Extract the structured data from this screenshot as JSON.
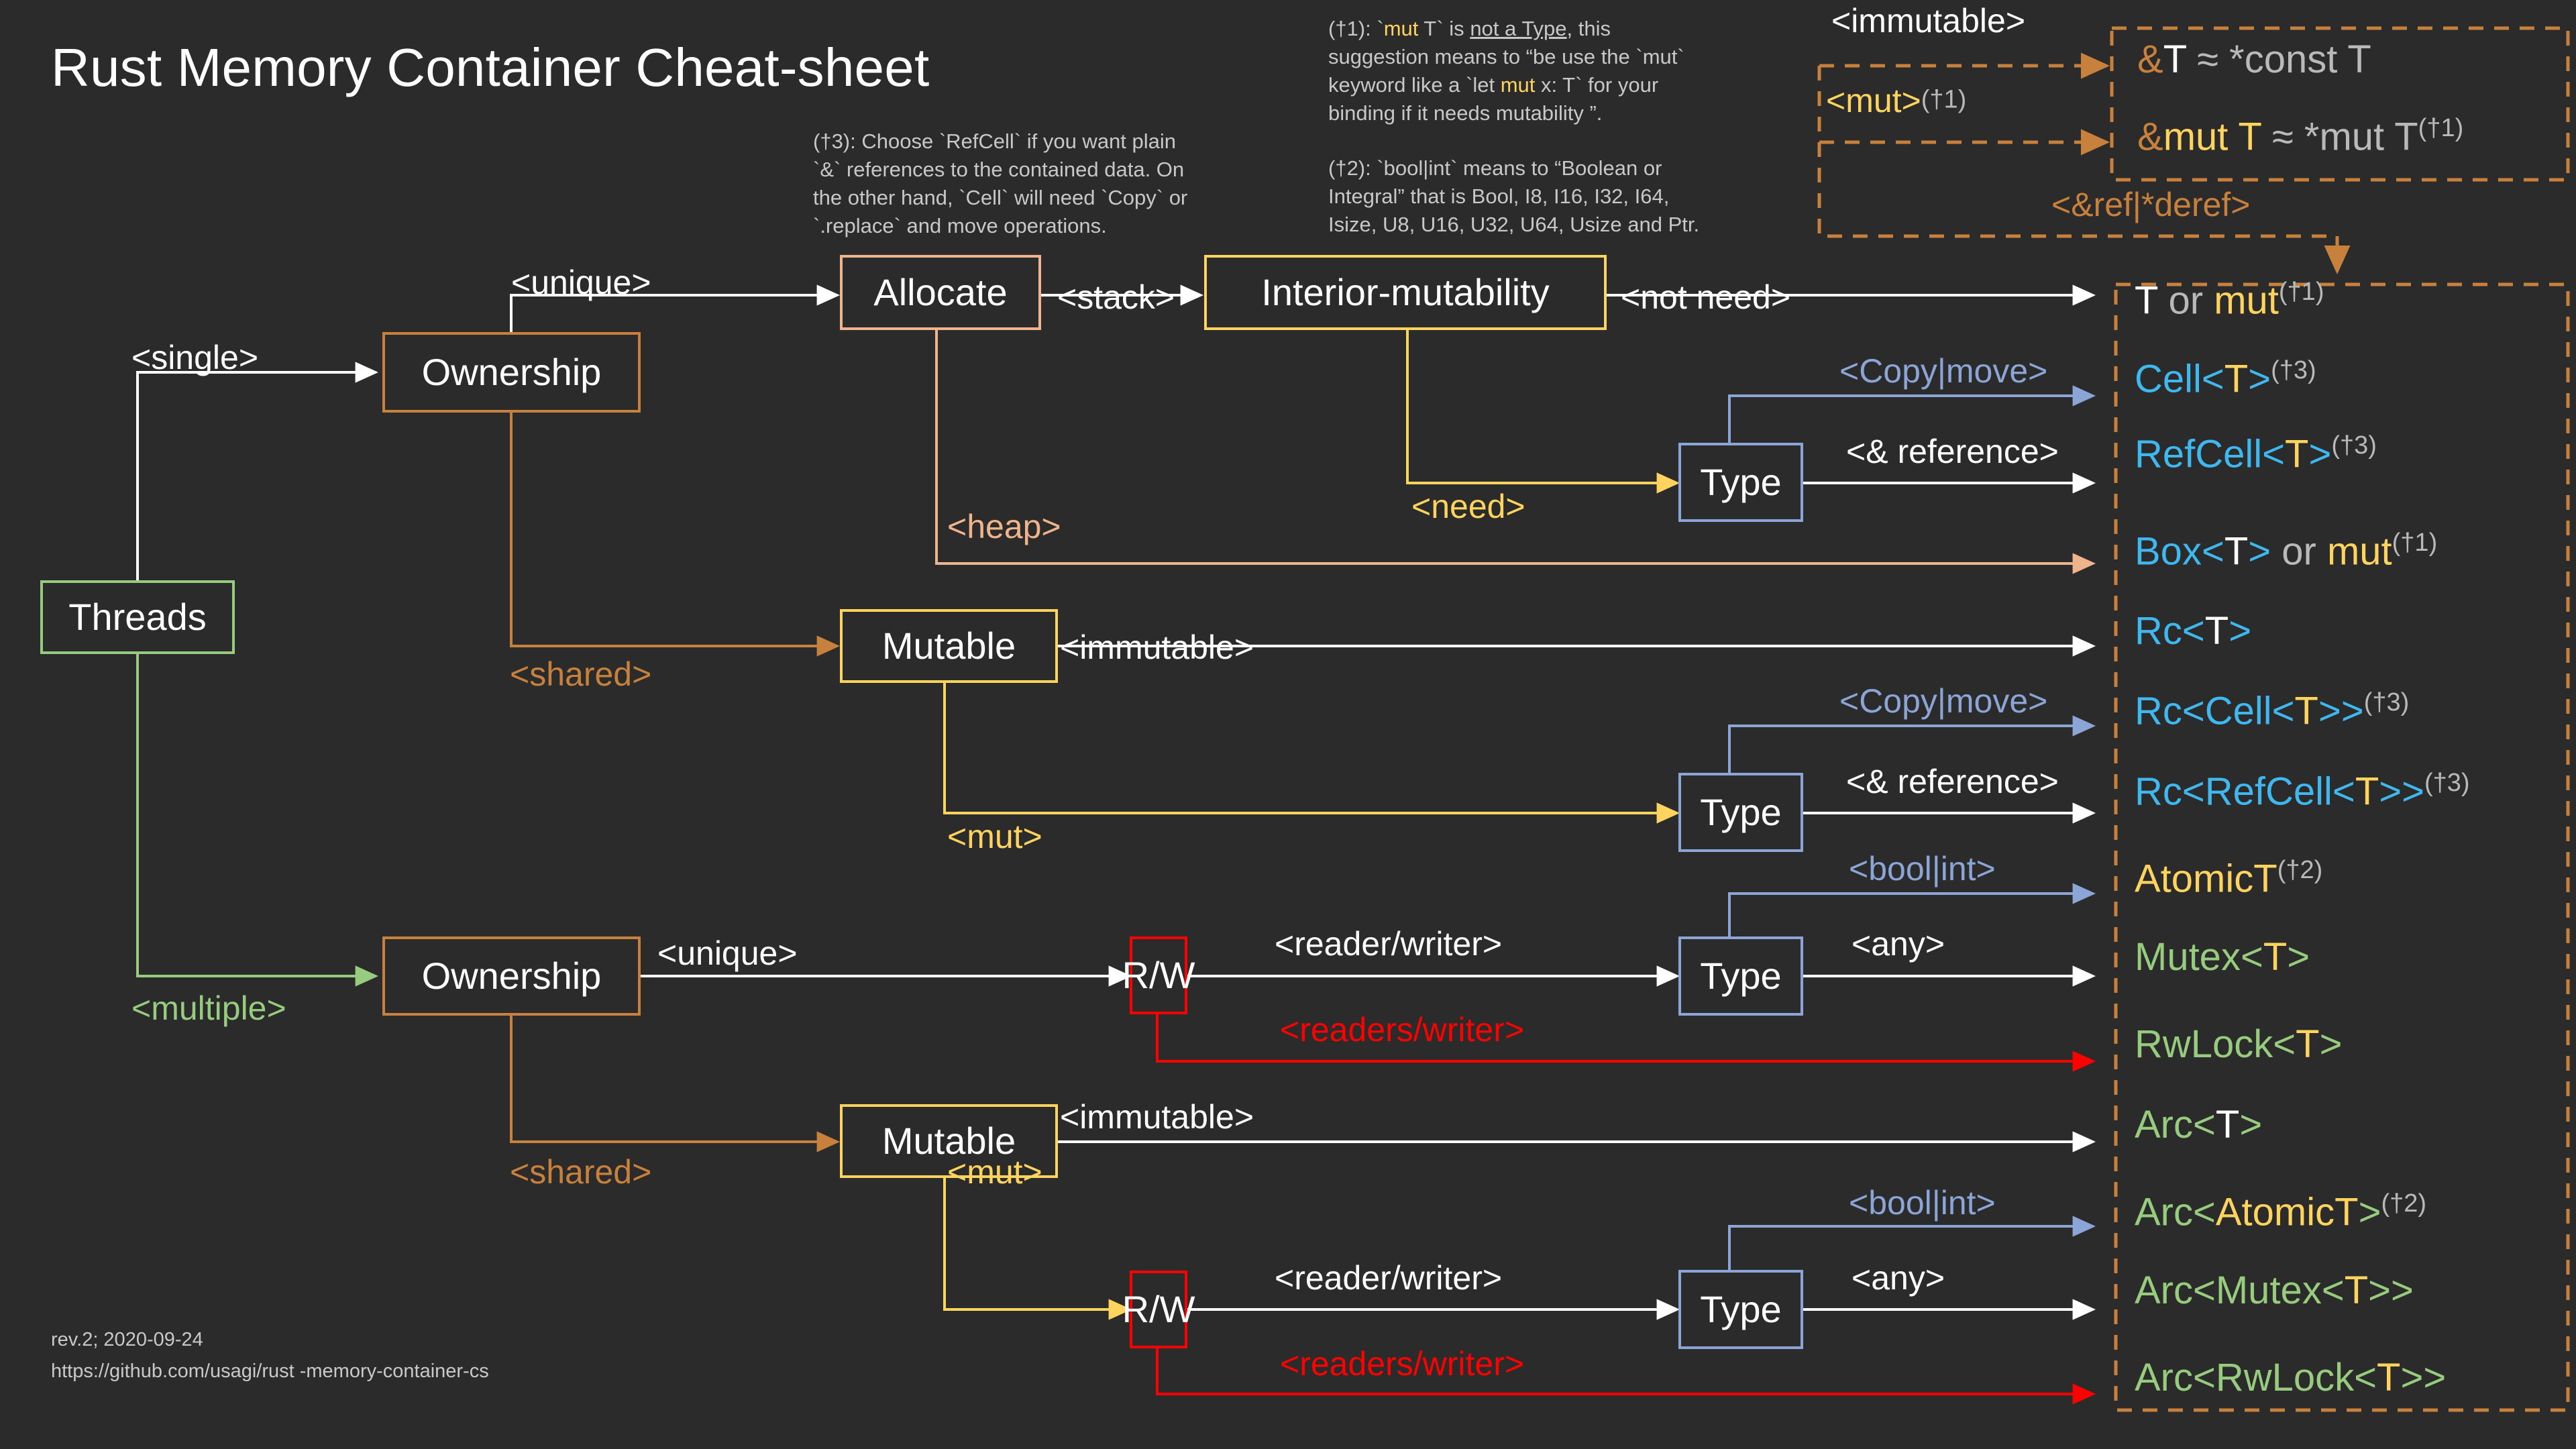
{
  "page": {
    "title": "Rust Memory Container Cheat-sheet",
    "background": "#2b2b2b",
    "footer_rev": "rev.2; 2020-09-24",
    "footer_url": "https://github.com/usagi/rust -memory-container-cs"
  },
  "colors": {
    "orange": "#c8813c",
    "peach": "#f0b48c",
    "yellow": "#ffd45e",
    "blue": "#8ba5d6",
    "green": "#97cc7e",
    "cyan": "#3fb8f0",
    "red": "#ff0000",
    "white": "#ffffff",
    "grey": "#b9b9b9"
  },
  "notes": {
    "n3": {
      "l1": "(†3): Choose `RefCell` if you want plain",
      "l2": "`&` references to the contained data. On",
      "l3": "the other hand, `Cell` will need `Copy` or",
      "l4": "`.replace` and move operations."
    },
    "n1": {
      "a": "(†1): `",
      "mut1": "mut",
      "b": " T` is ",
      "u": "not a Type",
      "c": ", this",
      "l2": "suggestion means to “be use the `mut`",
      "l3a": "keyword like a `let ",
      "mut2": "mut",
      "l3b": " x: T` for your",
      "l4": "binding if it needs mutability ”."
    },
    "n2": {
      "l1": "(†2): `bool|int` means to “Boolean or",
      "l2": "Integral” that is Bool, I8, I16, I32, I64,",
      "l3": "Isize, U8, U16, U32, U64,  Usize and Ptr."
    }
  },
  "nodes": {
    "threads": "Threads",
    "ownership_single": "Ownership",
    "allocate": "Allocate",
    "interior_mutability": "Interior-mutability",
    "type_1": "Type",
    "mutable_1": "Mutable",
    "type_2": "Type",
    "ownership_multi": "Ownership",
    "rw_1": "R/W",
    "type_3": "Type",
    "mutable_2": "Mutable",
    "rw_2": "R/W",
    "type_4": "Type"
  },
  "edge_labels": {
    "single": "<single>",
    "multiple": "<multiple>",
    "unique_1": "<unique>",
    "shared_1": "<shared>",
    "unique_2": "<unique>",
    "shared_2": "<shared>",
    "stack": "<stack>",
    "heap": "<heap>",
    "not_need": "<not need>",
    "need": "<need>",
    "copy_move_1": "<Copy|move>",
    "and_reference_1": "<& reference>",
    "immutable_1": "<immutable>",
    "mut_1": "<mut>",
    "copy_move_2": "<Copy|move>",
    "and_reference_2": "<& reference>",
    "reader_writer_1": "<reader/writer>",
    "readers_writer_1": "<readers/writer>",
    "bool_int_1": "<bool|int>",
    "any_1": "<any>",
    "immutable_2": "<immutable>",
    "mut_2": "<mut>",
    "reader_writer_2": "<reader/writer>",
    "readers_writer_2": "<readers/writer>",
    "bool_int_2": "<bool|int>",
    "any_2": "<any>"
  },
  "ref_panel": {
    "immutable": "<immutable>",
    "mut": "<mut>",
    "mut_sup": "(†1)",
    "row1": {
      "amp": "&",
      "t": "T",
      "approx": " ≈ ",
      "rhs": "*const T"
    },
    "row2": {
      "amp": "&",
      "mut": "mut",
      "t": " T",
      "approx": " ≈ ",
      "rhs": "*mut T",
      "sup": "(†1)"
    },
    "deref": "<&ref|*deref>"
  },
  "outputs": [
    {
      "id": "t-or-mut",
      "parts": [
        {
          "t": "T",
          "c": "white"
        },
        {
          "t": " or ",
          "c": "grey"
        },
        {
          "t": "mut",
          "c": "yellow"
        }
      ],
      "sup": "(†1)"
    },
    {
      "id": "cell",
      "parts": [
        {
          "t": "Cell<",
          "c": "cyan"
        },
        {
          "t": "T",
          "c": "yellow"
        },
        {
          "t": ">",
          "c": "cyan"
        }
      ],
      "sup": "(†3)"
    },
    {
      "id": "refcell",
      "parts": [
        {
          "t": "RefCell<",
          "c": "cyan"
        },
        {
          "t": "T",
          "c": "yellow"
        },
        {
          "t": ">",
          "c": "cyan"
        }
      ],
      "sup": "(†3)"
    },
    {
      "id": "box",
      "parts": [
        {
          "t": "Box<",
          "c": "cyan"
        },
        {
          "t": "T",
          "c": "white"
        },
        {
          "t": "> ",
          "c": "cyan"
        },
        {
          "t": "or ",
          "c": "grey"
        },
        {
          "t": "mut",
          "c": "yellow"
        }
      ],
      "sup": "(†1)"
    },
    {
      "id": "rc",
      "parts": [
        {
          "t": "Rc<",
          "c": "cyan"
        },
        {
          "t": "T",
          "c": "white"
        },
        {
          "t": ">",
          "c": "cyan"
        }
      ],
      "sup": ""
    },
    {
      "id": "rc-cell",
      "parts": [
        {
          "t": "Rc<Cell<",
          "c": "cyan"
        },
        {
          "t": "T",
          "c": "yellow"
        },
        {
          "t": ">>",
          "c": "cyan"
        }
      ],
      "sup": "(†3)"
    },
    {
      "id": "rc-refcell",
      "parts": [
        {
          "t": "Rc<RefCell<",
          "c": "cyan"
        },
        {
          "t": "T",
          "c": "yellow"
        },
        {
          "t": ">>",
          "c": "cyan"
        }
      ],
      "sup": "(†3)"
    },
    {
      "id": "atomict",
      "parts": [
        {
          "t": "AtomicT",
          "c": "yellow"
        }
      ],
      "sup": "(†2)"
    },
    {
      "id": "mutex",
      "parts": [
        {
          "t": "Mutex<",
          "c": "green"
        },
        {
          "t": "T",
          "c": "yellow"
        },
        {
          "t": ">",
          "c": "green"
        }
      ],
      "sup": ""
    },
    {
      "id": "rwlock",
      "parts": [
        {
          "t": "RwLock<",
          "c": "green"
        },
        {
          "t": "T",
          "c": "yellow"
        },
        {
          "t": ">",
          "c": "green"
        }
      ],
      "sup": ""
    },
    {
      "id": "arc",
      "parts": [
        {
          "t": "Arc<",
          "c": "green"
        },
        {
          "t": "T",
          "c": "white"
        },
        {
          "t": ">",
          "c": "green"
        }
      ],
      "sup": ""
    },
    {
      "id": "arc-atomict",
      "parts": [
        {
          "t": "Arc<",
          "c": "green"
        },
        {
          "t": "AtomicT",
          "c": "yellow"
        },
        {
          "t": ">",
          "c": "green"
        }
      ],
      "sup": "(†2)"
    },
    {
      "id": "arc-mutex",
      "parts": [
        {
          "t": "Arc<Mutex<",
          "c": "green"
        },
        {
          "t": "T",
          "c": "yellow"
        },
        {
          "t": ">>",
          "c": "green"
        }
      ],
      "sup": ""
    },
    {
      "id": "arc-rwlock",
      "parts": [
        {
          "t": "Arc<RwLock<",
          "c": "green"
        },
        {
          "t": "T",
          "c": "yellow"
        },
        {
          "t": ">>",
          "c": "green"
        }
      ],
      "sup": ""
    }
  ]
}
